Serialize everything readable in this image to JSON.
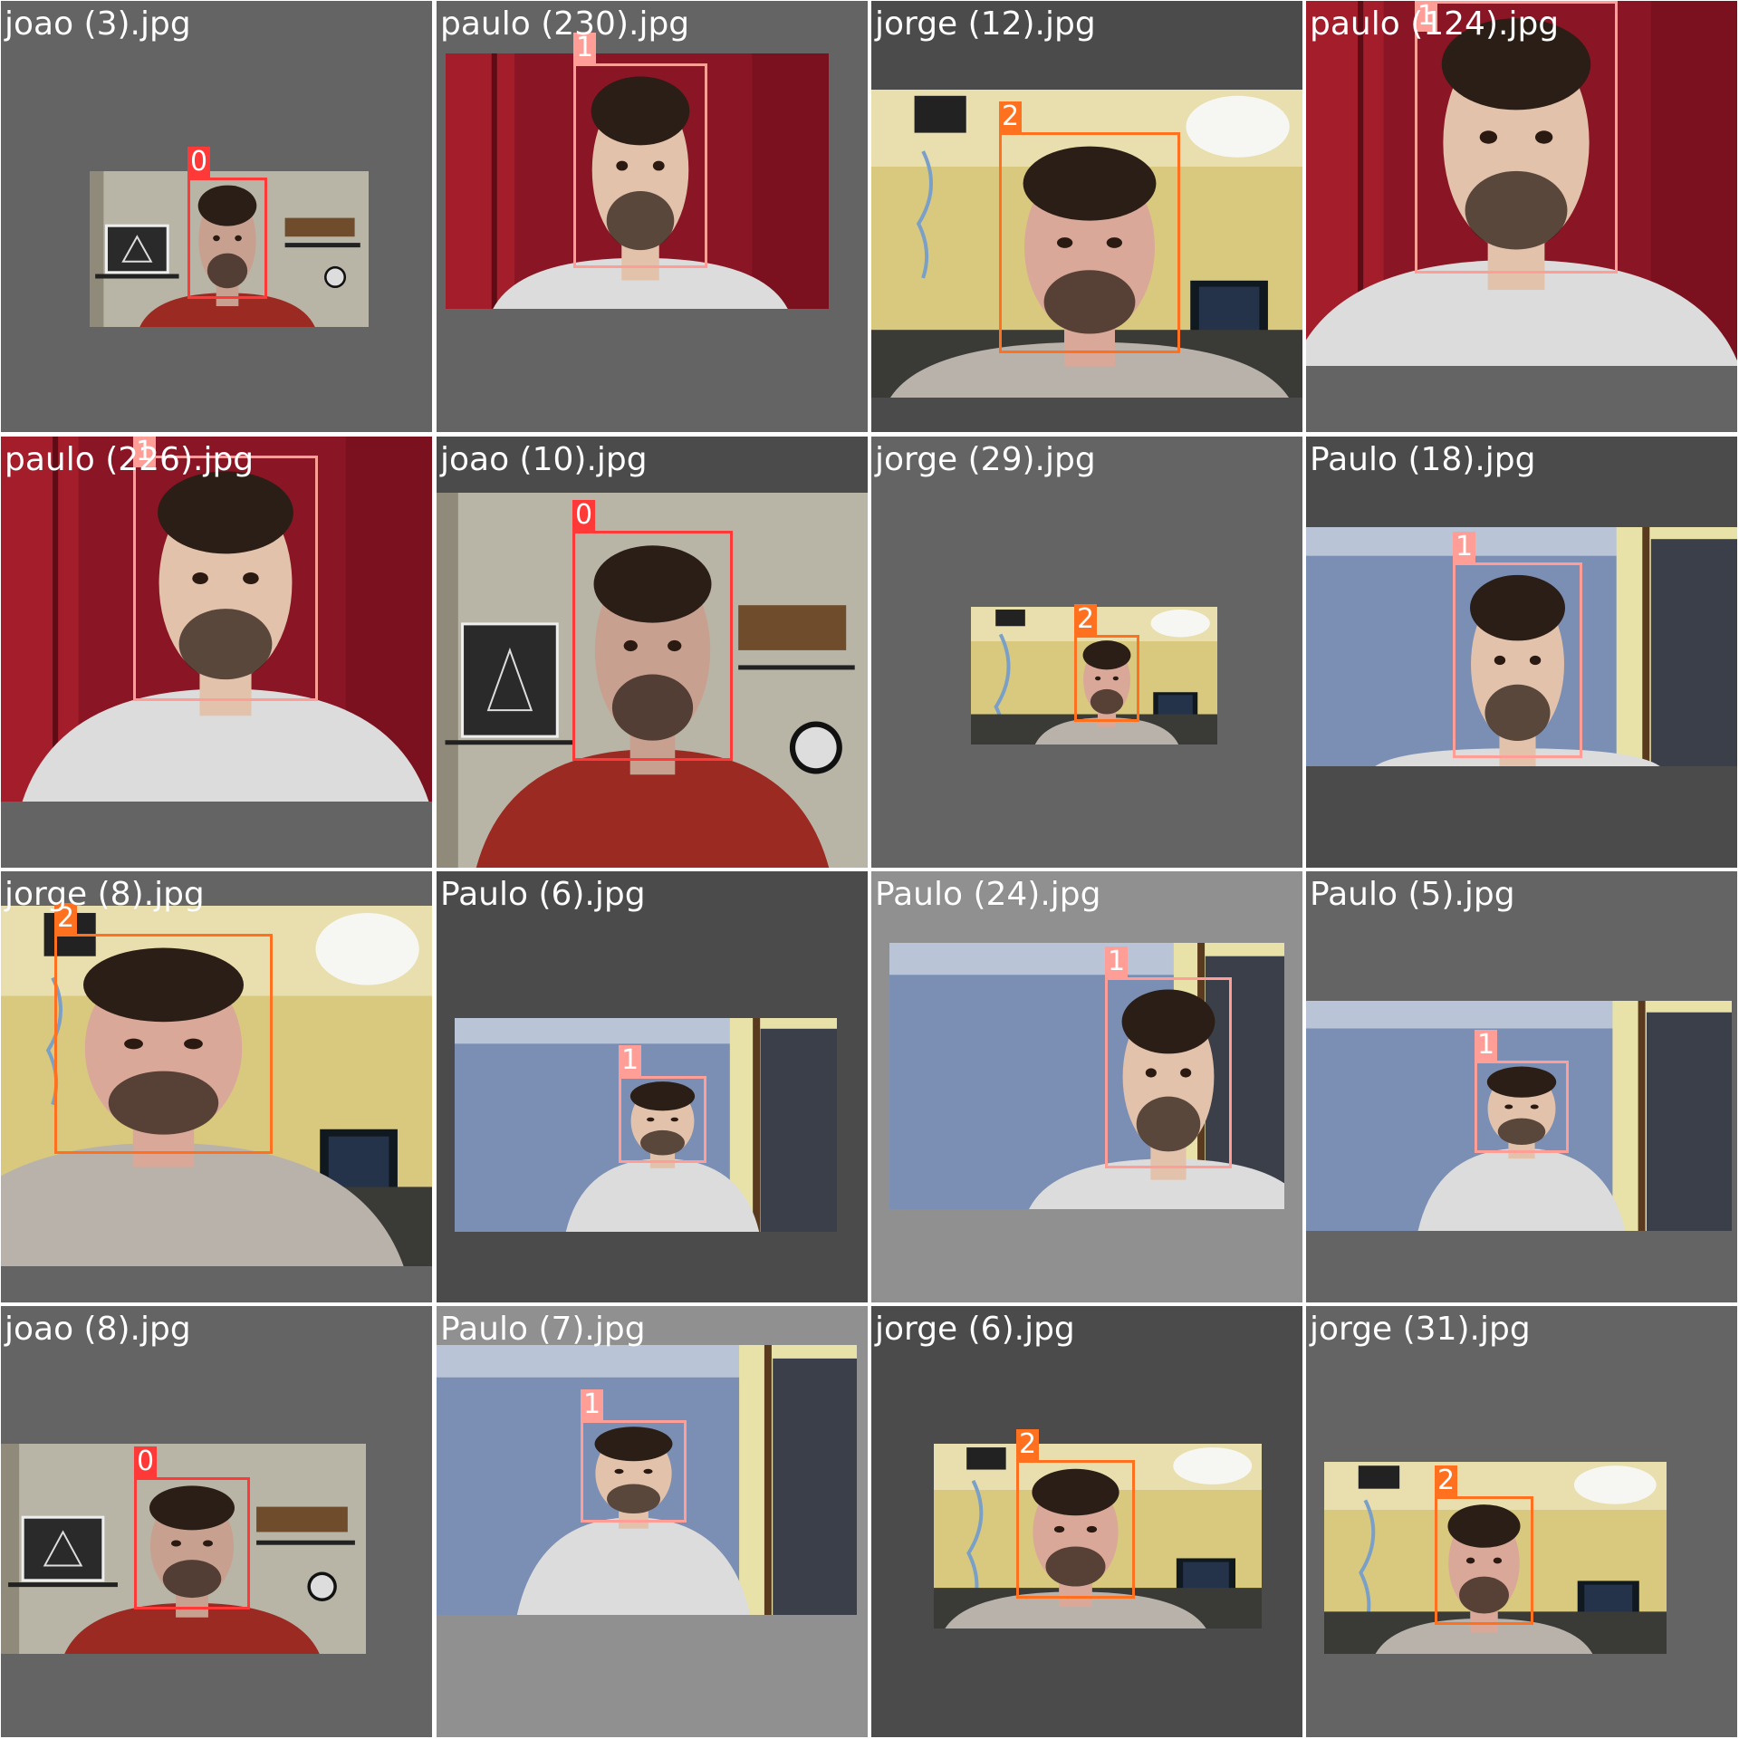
{
  "colors": {
    "0": "#ff3838",
    "1": "#ff9d97",
    "2": "#ff701f"
  },
  "tiles": [
    {
      "file": "joao (3).jpg",
      "label": "0",
      "scene": "joao-room"
    },
    {
      "file": "paulo (230).jpg",
      "label": "1",
      "scene": "paulo-red"
    },
    {
      "file": "jorge (12).jpg",
      "label": "2",
      "scene": "jorge-room"
    },
    {
      "file": "paulo (124).jpg",
      "label": "1",
      "scene": "paulo-red"
    },
    {
      "file": "paulo (226).jpg",
      "label": "1",
      "scene": "paulo-red"
    },
    {
      "file": "joao (10).jpg",
      "label": "0",
      "scene": "joao-room"
    },
    {
      "file": "jorge (29).jpg",
      "label": "2",
      "scene": "jorge-room"
    },
    {
      "file": "Paulo (18).jpg",
      "label": "1",
      "scene": "paulo-blue"
    },
    {
      "file": "jorge (8).jpg",
      "label": "2",
      "scene": "jorge-room"
    },
    {
      "file": "Paulo (6).jpg",
      "label": "1",
      "scene": "paulo-blue"
    },
    {
      "file": "Paulo (24).jpg",
      "label": "1",
      "scene": "paulo-blue"
    },
    {
      "file": "Paulo (5).jpg",
      "label": "1",
      "scene": "paulo-blue"
    },
    {
      "file": "joao (8).jpg",
      "label": "0",
      "scene": "joao-room"
    },
    {
      "file": "Paulo (7).jpg",
      "label": "1",
      "scene": "paulo-blue"
    },
    {
      "file": "jorge (6).jpg",
      "label": "2",
      "scene": "jorge-room"
    },
    {
      "file": "jorge (31).jpg",
      "label": "2",
      "scene": "jorge-room"
    }
  ]
}
